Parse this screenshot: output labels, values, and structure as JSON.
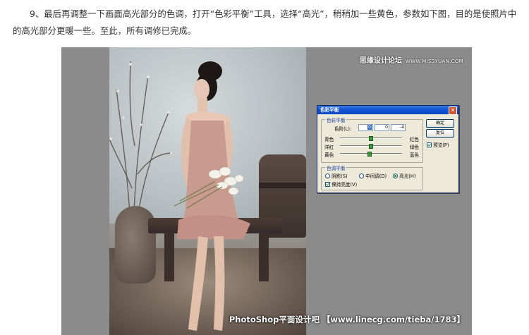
{
  "article": {
    "paragraph": "9、最后再调整一下画面高光部分的色调，打开“色彩平衡”工具，选择“高光”，稍稍加一些黄色，参数如下图，目的是使照片中的高光部分更暖一些。至此，所有调修已完成。"
  },
  "image": {
    "watermark_top": "思缘设计论坛",
    "watermark_site": "WWW.MISSYUAN.COM",
    "watermark_bottom": "PhotoShop平面设计吧 【www.linecg.com/tieba/1783】"
  },
  "dialog": {
    "title": "色彩平衡",
    "close": "×",
    "balance_group": "色彩平衡",
    "levels_label": "色阶(L):",
    "levels": [
      "0",
      "0",
      "-4"
    ],
    "sliders": [
      {
        "left": "青色",
        "right": "红色",
        "value": 0
      },
      {
        "left": "洋红",
        "right": "绿色",
        "value": 0
      },
      {
        "left": "黄色",
        "right": "蓝色",
        "value": -4
      }
    ],
    "tone_group": "色调平衡",
    "tones": [
      "阴影(S)",
      "中间调(D)",
      "高光(H)"
    ],
    "selected_tone": "高光(H)",
    "preserve_label": "保持亮度(V)",
    "preserve_checked": true,
    "ok_label": "确定",
    "reset_label": "复位",
    "preview_label": "预览(P)",
    "preview_checked": true
  },
  "colors": {
    "titlebar": "#0a46c4",
    "dialog_bg": "#ece9d8",
    "frame_bg": "#8b8b8b"
  }
}
